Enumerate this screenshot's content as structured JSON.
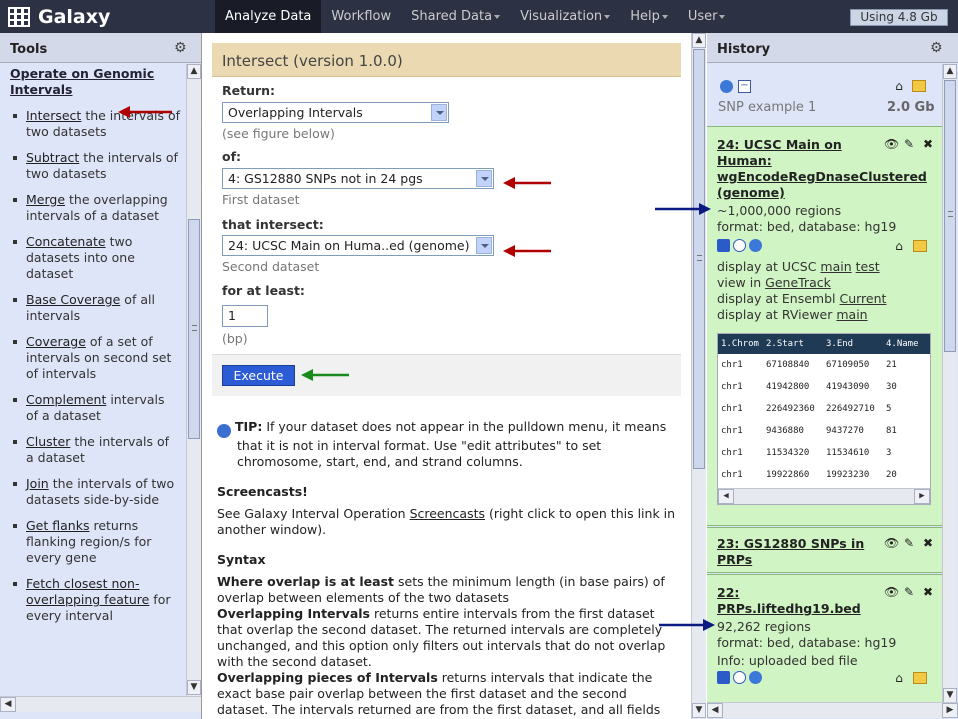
{
  "masthead": {
    "brand": "Galaxy",
    "nav": [
      {
        "label": "Analyze Data",
        "active": true,
        "dropdown": false
      },
      {
        "label": "Workflow",
        "active": false,
        "dropdown": false
      },
      {
        "label": "Shared Data",
        "active": false,
        "dropdown": true
      },
      {
        "label": "Visualization",
        "active": false,
        "dropdown": true
      },
      {
        "label": "Help",
        "active": false,
        "dropdown": true
      },
      {
        "label": "User",
        "active": false,
        "dropdown": true
      }
    ],
    "quota": "Using 4.8 Gb"
  },
  "tools": {
    "title": "Tools",
    "section": "Operate on Genomic Intervals",
    "items": [
      {
        "name": "Intersect",
        "desc": "the intervals of two datasets"
      },
      {
        "name": "Subtract",
        "desc": "the intervals of two datasets"
      },
      {
        "name": "Merge",
        "desc": "the overlapping intervals of a dataset"
      },
      {
        "name": "Concatenate",
        "desc": "two datasets into one dataset"
      },
      {
        "name": "Base Coverage",
        "desc": "of all intervals"
      },
      {
        "name": "Coverage",
        "desc": "of a set of intervals on second set of intervals"
      },
      {
        "name": "Complement",
        "desc": "intervals of a dataset"
      },
      {
        "name": "Cluster",
        "desc": "the intervals of a dataset"
      },
      {
        "name": "Join",
        "desc": "the intervals of two datasets side-by-side"
      },
      {
        "name": "Get flanks",
        "desc": "returns flanking region/s for every gene"
      },
      {
        "name": "Fetch closest non-overlapping feature",
        "desc": "for every interval"
      }
    ]
  },
  "form": {
    "title": "Intersect (version 1.0.0)",
    "return_label": "Return:",
    "return_value": "Overlapping Intervals",
    "return_help": "(see figure below)",
    "of_label": "of:",
    "of_value": "4: GS12880 SNPs not in 24 pgs",
    "of_help": "First dataset",
    "intersect_label": "that intersect:",
    "intersect_value": "24: UCSC Main on Huma..ed (genome)",
    "intersect_help": "Second dataset",
    "atleast_label": "for at least:",
    "atleast_value": "1",
    "atleast_help": "(bp)",
    "execute": "Execute"
  },
  "help": {
    "tip_label": "TIP:",
    "tip_text": "If your dataset does not appear in the pulldown menu, it means that it is not in interval format. Use \"edit attributes\" to set chromosome, start, end, and strand columns.",
    "screencasts_title": "Screencasts!",
    "screencasts_pre": "See Galaxy Interval Operation ",
    "screencasts_link": "Screencasts",
    "screencasts_post": " (right click to open this link in another window).",
    "syntax_title": "Syntax",
    "p1_bold": "Where overlap is at least",
    "p1_text": " sets the minimum length (in base pairs) of overlap between elements of the two datasets",
    "p2_bold": "Overlapping Intervals",
    "p2_text": " returns entire intervals from the first dataset that overlap the second dataset. The returned intervals are completely unchanged, and this option only filters out intervals that do not overlap with the second dataset.",
    "p3_bold": "Overlapping pieces of Intervals",
    "p3_text": " returns intervals that indicate the exact base pair overlap between the first dataset and the second dataset. The intervals returned are from the first dataset, and all fields"
  },
  "history": {
    "title": "History",
    "name": "SNP example 1",
    "size": "2.0 Gb",
    "items": [
      {
        "title": "24: UCSC Main on Human: wgEncodeRegDnaseClustered (genome)",
        "regions": "~1,000,000 regions",
        "format": "format: bed, database: hg19",
        "ucsc_pre": "display at UCSC ",
        "ucsc_main": "main",
        "ucsc_test": "test",
        "view_pre": "view in ",
        "view_link": "GeneTrack",
        "ensembl_pre": "display at Ensembl ",
        "ensembl_link": "Current",
        "rviewer_pre": "display at RViewer ",
        "rviewer_link": "main"
      },
      {
        "title": "23: GS12880 SNPs in PRPs"
      },
      {
        "title": "22: PRPs.liftedhg19.bed",
        "regions": "92,262 regions",
        "format": "format: bed, database: hg19",
        "info": "Info: uploaded bed file"
      }
    ],
    "peek": {
      "columns": [
        "1.Chrom",
        "2.Start",
        "3.End",
        "4.Name"
      ],
      "rows": [
        [
          "chr1",
          "67108840",
          "67109050",
          "21"
        ],
        [
          "chr1",
          "41942800",
          "41943090",
          "30"
        ],
        [
          "chr1",
          "226492360",
          "226492710",
          "5"
        ],
        [
          "chr1",
          "9436880",
          "9437270",
          "81"
        ],
        [
          "chr1",
          "11534320",
          "11534610",
          "3"
        ],
        [
          "chr1",
          "19922860",
          "19923230",
          "20"
        ]
      ]
    }
  },
  "colors": {
    "masthead": "#2c3143",
    "panel_bg": "#dfe5f9",
    "dataset_ok": "#d0f4c4",
    "form_title": "#ebd9b2",
    "execute": "#2c5bd6",
    "arrow_red": "#b00000",
    "arrow_blue": "#0a1a80",
    "arrow_green": "#1a8a1a"
  },
  "icons": [
    "galaxy-logo-icon",
    "gear-icon",
    "refresh-icon",
    "collapse-icon",
    "tag-icon",
    "annotation-icon",
    "eye-icon",
    "pencil-icon",
    "delete-icon",
    "save-icon",
    "info-icon",
    "rerun-icon",
    "info-circle-icon"
  ]
}
